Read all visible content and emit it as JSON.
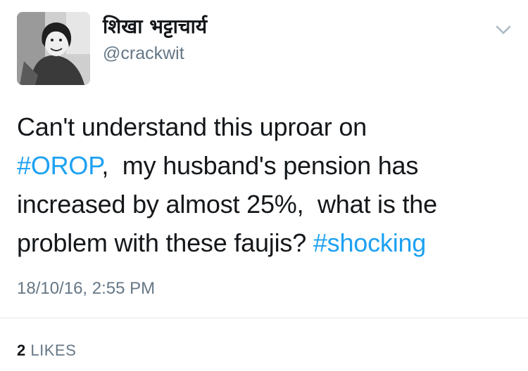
{
  "author": {
    "display_name": "शिखा भट्टाचार्य",
    "handle": "@crackwit",
    "avatar_icon": "profile-photo"
  },
  "tweet": {
    "lines": [
      [
        {
          "text": "Can't understand this uproar on"
        }
      ],
      [
        {
          "text": "#OROP",
          "hashtag": true
        },
        {
          "text": ",  my husband's pension has"
        }
      ],
      [
        {
          "text": "increased by almost 25%,  what is the"
        }
      ],
      [
        {
          "text": "problem with these faujis? "
        },
        {
          "text": "#shocking",
          "hashtag": true
        }
      ]
    ],
    "timestamp": "18/10/16, 2:55 PM"
  },
  "stats": {
    "likes_count": "2",
    "likes_label": "LIKES"
  },
  "menu": {
    "icon": "chevron-down-icon"
  },
  "colors": {
    "hashtag": "#1da1f2",
    "text": "#14171a",
    "muted": "#657786"
  }
}
